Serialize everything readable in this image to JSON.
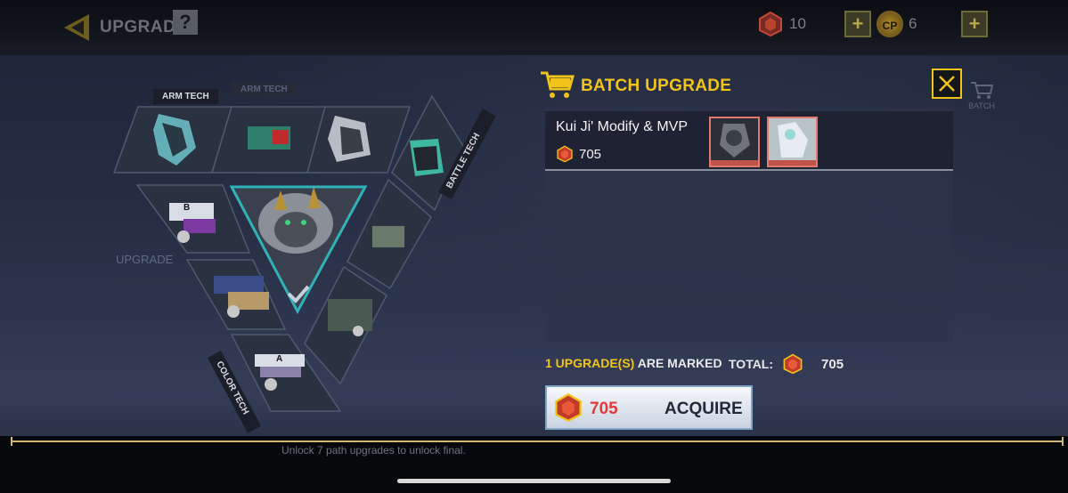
{
  "topbar": {
    "title": "UPGRADE",
    "help": "?",
    "gems": "10",
    "cp_badge": "CP",
    "cp": "6",
    "plus": "+"
  },
  "tree": {
    "arm_tech": "ARM TECH",
    "arm_tech_ghost": "ARM TECH",
    "battle_tech": "BATTLE TECH",
    "color_tech": "COLOR TECH",
    "card_b": "B",
    "card_a": "A",
    "upgrade_ghost": "UPGRADE"
  },
  "modal": {
    "title": "BATCH UPGRADE",
    "side_label": "BATCH",
    "item": {
      "name": "Kui Ji' Modify & MVP",
      "cost": "705"
    },
    "marked_count": "1 UPGRADE(S)",
    "marked_suffix": "ARE MARKED",
    "total_label": "TOTAL:",
    "total_value": "705",
    "acquire_price": "705",
    "acquire_label": "ACQUIRE"
  },
  "bottom": {
    "hint": "Unlock 7 path upgrades to unlock final."
  },
  "colors": {
    "accent": "#f0c419",
    "price_red": "#e23a3a",
    "thumb_red": "#c0524a"
  },
  "icons": [
    "back-arrow-icon",
    "help-icon",
    "gem-icon",
    "cp-coin-icon",
    "plus-icon",
    "cart-icon",
    "close-icon",
    "checkmark-icon"
  ]
}
